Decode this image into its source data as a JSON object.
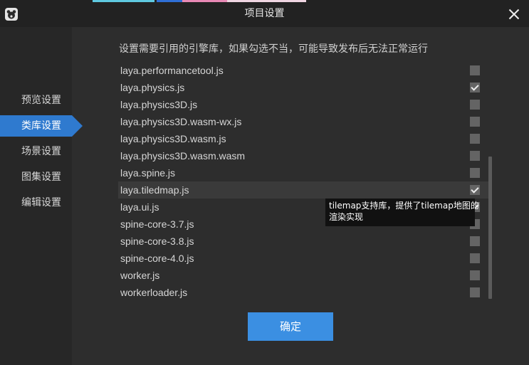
{
  "window": {
    "title": "项目设置"
  },
  "icons": {
    "logo": "laya-logo-icon",
    "close": "close-icon",
    "check": "check-icon"
  },
  "sidebar": {
    "items": [
      {
        "label": "预览设置",
        "selected": false
      },
      {
        "label": "类库设置",
        "selected": true
      },
      {
        "label": "场景设置",
        "selected": false
      },
      {
        "label": "图集设置",
        "selected": false
      },
      {
        "label": "编辑设置",
        "selected": false
      }
    ]
  },
  "main": {
    "description": "设置需要引用的引擎库，如果勾选不当，可能导致发布后无法正常运行",
    "libraries": [
      {
        "name": "laya.performancetool.js",
        "checked": false
      },
      {
        "name": "laya.physics.js",
        "checked": true
      },
      {
        "name": "laya.physics3D.js",
        "checked": false
      },
      {
        "name": "laya.physics3D.wasm-wx.js",
        "checked": false
      },
      {
        "name": "laya.physics3D.wasm.js",
        "checked": false
      },
      {
        "name": "laya.physics3D.wasm.wasm",
        "checked": false
      },
      {
        "name": "laya.spine.js",
        "checked": false
      },
      {
        "name": "laya.tiledmap.js",
        "checked": true,
        "hovered": true
      },
      {
        "name": "laya.ui.js",
        "checked": true
      },
      {
        "name": "spine-core-3.7.js",
        "checked": false
      },
      {
        "name": "spine-core-3.8.js",
        "checked": false
      },
      {
        "name": "spine-core-4.0.js",
        "checked": false
      },
      {
        "name": "worker.js",
        "checked": false
      },
      {
        "name": "workerloader.js",
        "checked": false
      }
    ],
    "tooltip": {
      "lines": [
        "tilemap支持库，提供了tilemap地图的",
        "渲染实现"
      ]
    }
  },
  "footer": {
    "confirm_label": "确定"
  },
  "colors": {
    "accent": "#3b8fe2",
    "nav_selected": "#2f7acf",
    "titlebar_bg": "#222222",
    "sidebar_bg": "#272727",
    "main_bg": "#2d2d2d",
    "row_hover_bg": "#3a3a3a",
    "tooltip_bg": "#111111",
    "checkbox_bg": "#646464",
    "scrollbar": "#5b5b5b"
  }
}
